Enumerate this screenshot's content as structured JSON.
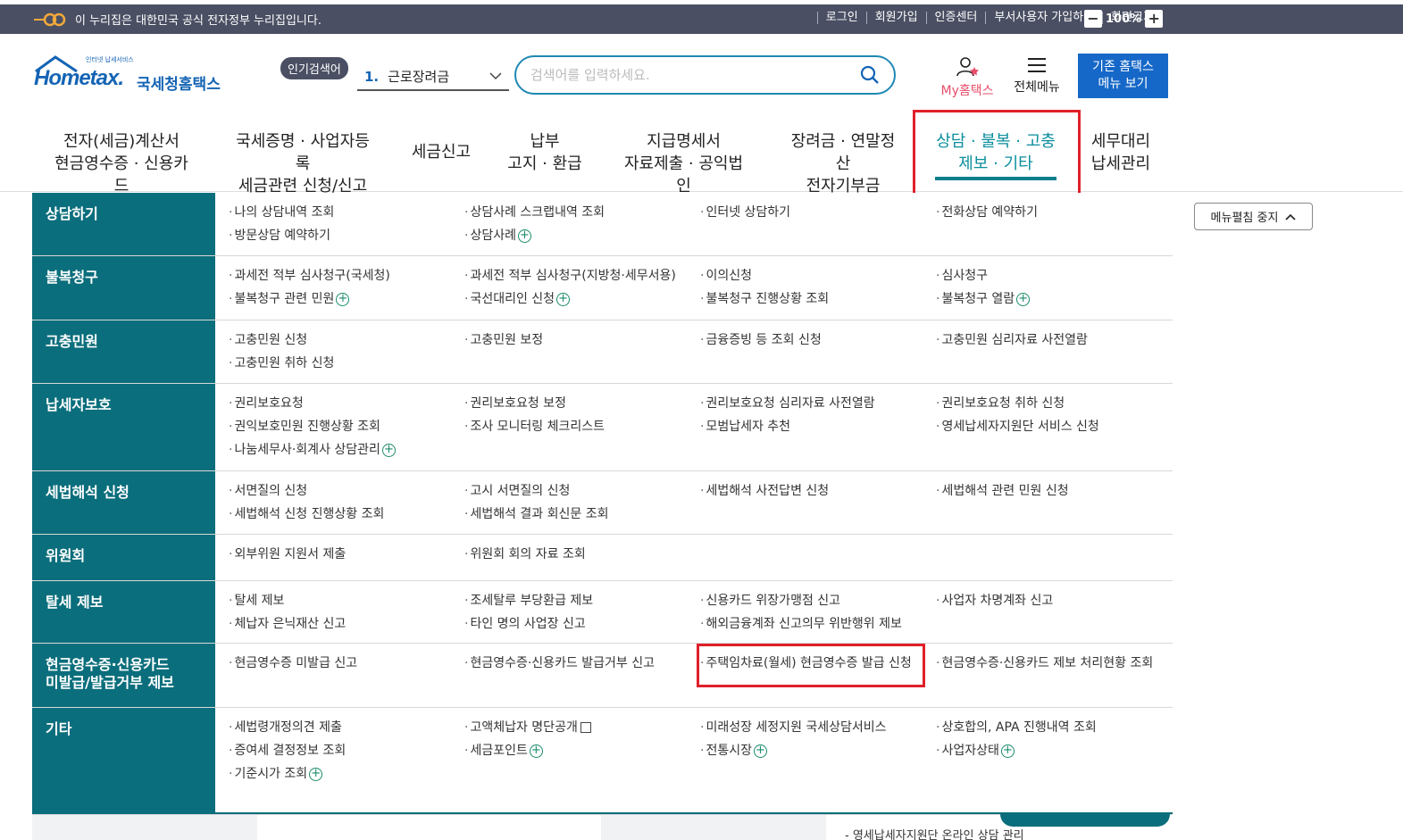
{
  "gov_bar": {
    "notice": "이 누리집은 대한민국 공식 전자정부 누리집입니다.",
    "links": [
      "로그인",
      "회원가입",
      "인증센터",
      "부서사용자 가입하기",
      "화면크기"
    ],
    "zoom_minus": "−",
    "zoom_level": "100%",
    "zoom_plus": "+"
  },
  "header": {
    "logo_tag": "인터넷 납세서비스",
    "logo_main": "Hometax.",
    "logo_kor": "국세청홈택스",
    "popular_badge": "인기검색어",
    "popular_rank": "1.",
    "popular_term": "근로장려금",
    "search_placeholder": "검색어를 입력하세요.",
    "my_hometax": "My홈택스",
    "all_menu": "전체메뉴",
    "old_menu_line1": "기존 홈택스",
    "old_menu_line2": "메뉴 보기"
  },
  "nav": [
    {
      "l1": "전자(세금)계산서",
      "l2": "현금영수증 · 신용카드"
    },
    {
      "l1": "국세증명 · 사업자등록",
      "l2": "세금관련 신청/신고"
    },
    {
      "l1": "세금신고",
      "l2": ""
    },
    {
      "l1": "납부",
      "l2": "고지 · 환급"
    },
    {
      "l1": "지급명세서",
      "l2": "자료제출 · 공익법인"
    },
    {
      "l1": "장려금 · 연말정산",
      "l2": "전자기부금"
    },
    {
      "l1": "상담 · 불복 · 고충",
      "l2": "제보 · 기타"
    },
    {
      "l1": "세무대리",
      "l2": "납세관리"
    }
  ],
  "collapse_button": "메뉴펼침 중지",
  "sections": [
    {
      "cat": "상담하기",
      "links": [
        [
          "나의 상담내역 조회",
          "상담사례 스크랩내역 조회",
          "인터넷 상담하기",
          "전화상담 예약하기"
        ],
        [
          "방문상담 예약하기",
          "상담사례",
          "",
          ""
        ]
      ]
    },
    {
      "cat": "불복청구",
      "links": [
        [
          "과세전 적부 심사청구(국세청)",
          "과세전 적부 심사청구(지방청·세무서용)",
          "이의신청",
          "심사청구"
        ],
        [
          "불복청구 관련 민원",
          "국선대리인 신청",
          "불복청구 진행상황 조회",
          "불복청구 열람"
        ]
      ]
    },
    {
      "cat": "고충민원",
      "links": [
        [
          "고충민원 신청",
          "고충민원 보정",
          "금융증빙 등 조회 신청",
          "고충민원 심리자료 사전열람"
        ],
        [
          "고충민원 취하 신청",
          "",
          "",
          ""
        ]
      ]
    },
    {
      "cat": "납세자보호",
      "links": [
        [
          "권리보호요청",
          "권리보호요청 보정",
          "권리보호요청 심리자료 사전열람",
          "권리보호요청 취하 신청"
        ],
        [
          "권익보호민원 진행상황 조회",
          "조사 모니터링 체크리스트",
          "모범납세자 추천",
          "영세납세자지원단 서비스 신청"
        ],
        [
          "나눔세무사·회계사 상담관리",
          "",
          "",
          ""
        ]
      ]
    },
    {
      "cat": "세법해석 신청",
      "links": [
        [
          "서면질의 신청",
          "고시 서면질의 신청",
          "세법해석 사전답변 신청",
          "세법해석 관련 민원 신청"
        ],
        [
          "세법해석 신청 진행상황 조회",
          "세법해석 결과 회신문 조회",
          "",
          ""
        ]
      ]
    },
    {
      "cat": "위원회",
      "links": [
        [
          "외부위원 지원서 제출",
          "위원회 회의 자료 조회",
          "",
          ""
        ]
      ]
    },
    {
      "cat": "탈세 제보",
      "links": [
        [
          "탈세 제보",
          "조세탈루 부당환급 제보",
          "신용카드 위장가맹점 신고",
          "사업자 차명계좌 신고"
        ],
        [
          "체납자 은닉재산 신고",
          "타인 명의 사업장 신고",
          "해외금융계좌 신고의무 위반행위 제보",
          ""
        ]
      ]
    },
    {
      "cat": "현금영수증·신용카드 미발급/발급거부 제보",
      "cat_l1": "현금영수증·신용카드",
      "cat_l2": "미발급/발급거부 제보",
      "links": [
        [
          "현금영수증 미발급 신고",
          "현금영수증·신용카드 발급거부 신고",
          "주택임차료(월세) 현금영수증 발급 신청",
          "현금영수증·신용카드 제보 처리현황 조회"
        ]
      ]
    },
    {
      "cat": "기타",
      "links": [
        [
          "세법령개정의견 제출",
          "고액체납자 명단공개",
          "미래성장 세정지원 국세상담서비스",
          "상호합의, APA 진행내역 조회"
        ],
        [
          "증여세 결정정보 조회",
          "세금포인트",
          "전통시장",
          "사업자상태"
        ],
        [
          "기준시가 조회",
          "",
          "",
          ""
        ]
      ]
    }
  ],
  "bottom_text": "- 영세납세자지원단 온라인 상담 관리",
  "colors": {
    "accent": "#0b6e7c",
    "highlight": "#e0202a",
    "brand": "#1464b4"
  }
}
